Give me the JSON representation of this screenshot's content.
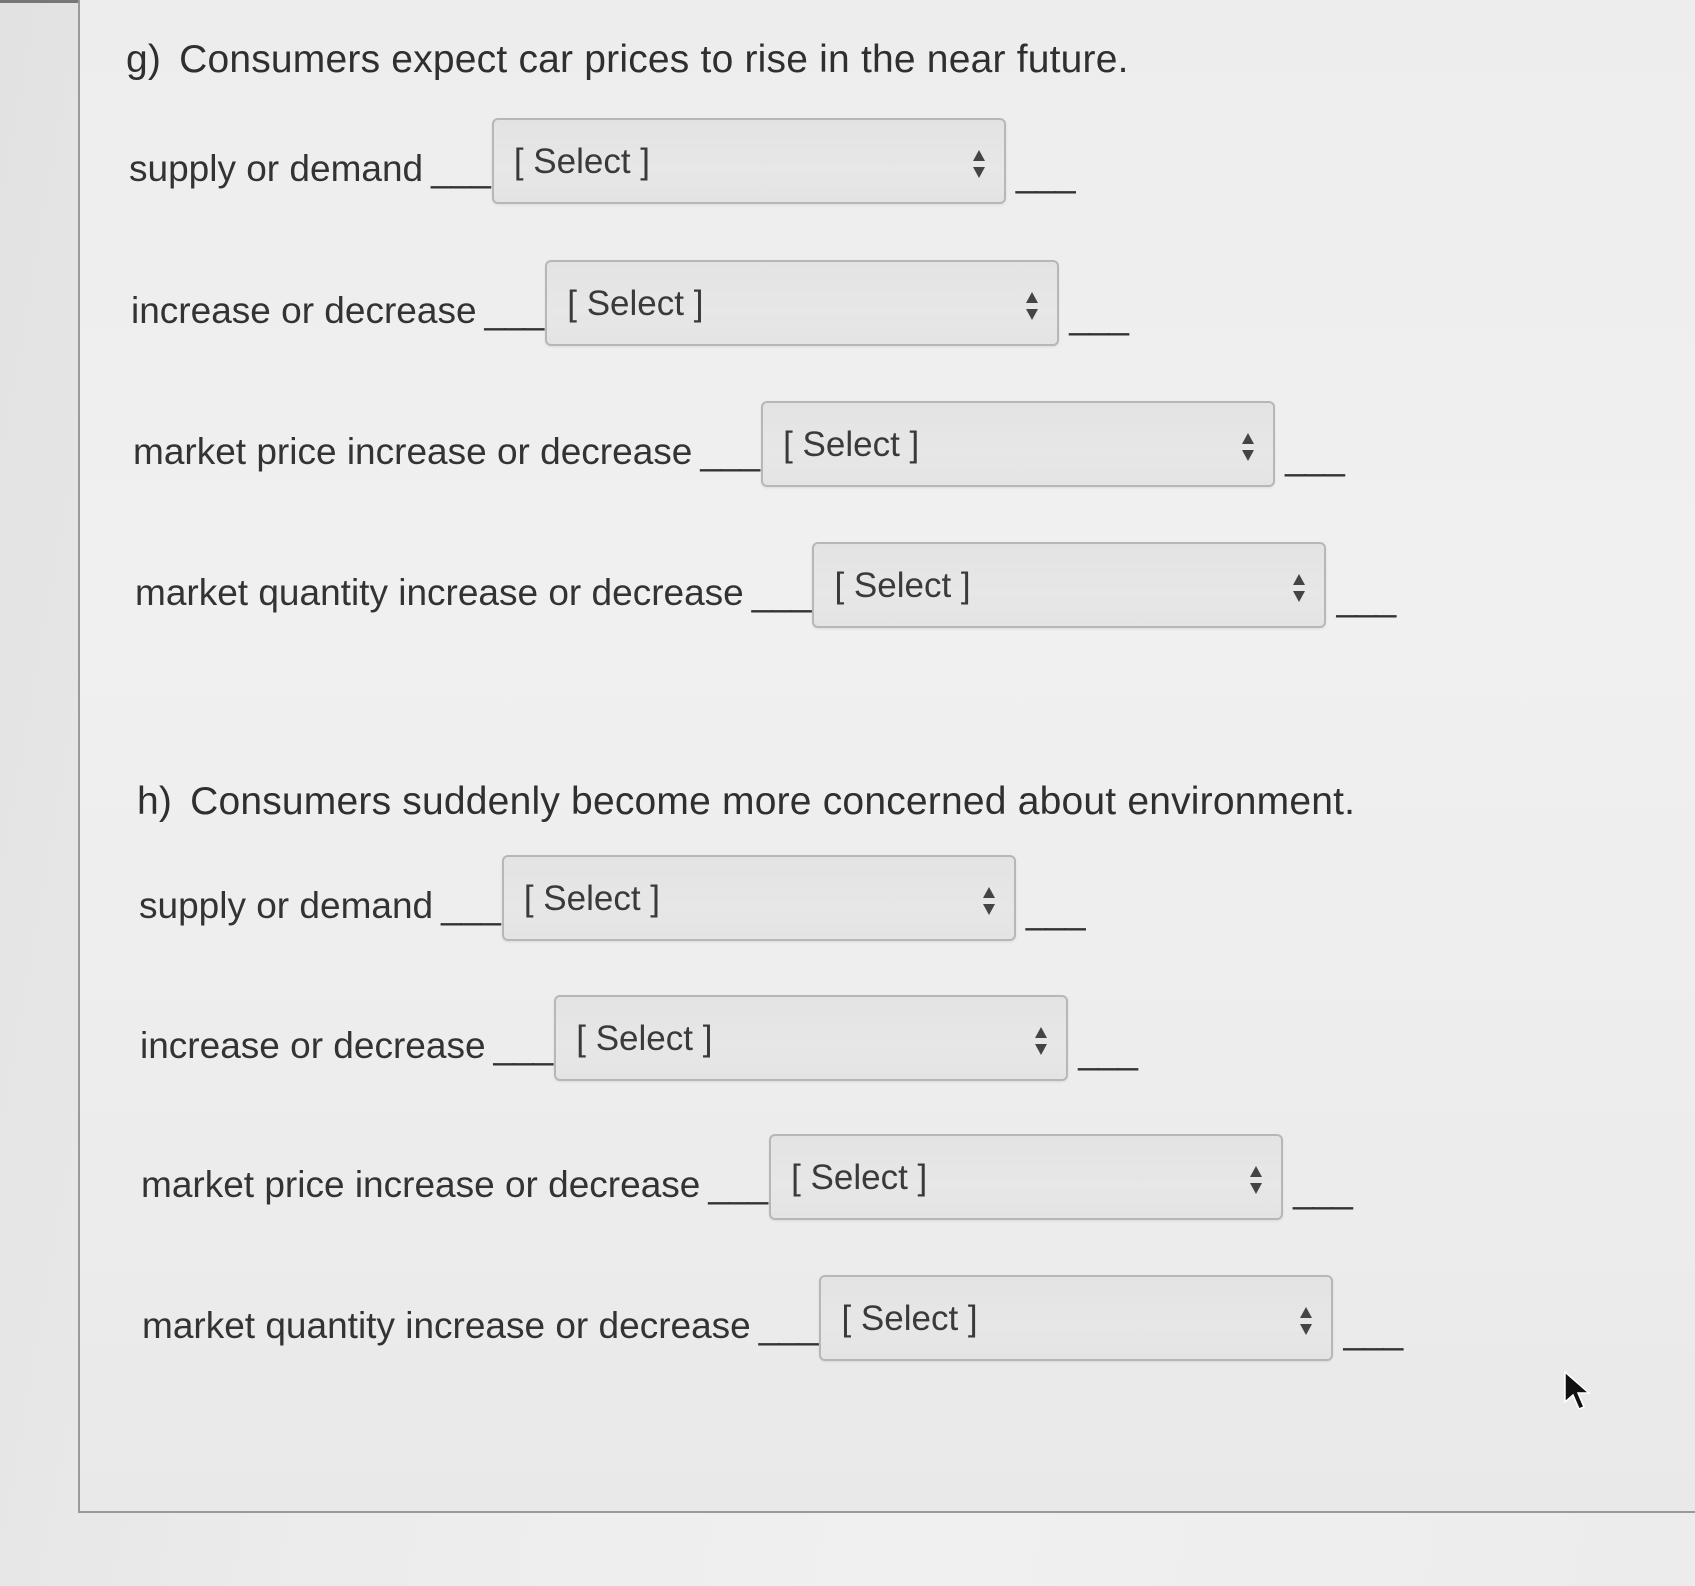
{
  "questions": [
    {
      "letter": "g)",
      "title": "Consumers expect car prices to rise in the near future.",
      "rows": [
        {
          "label": "supply or demand",
          "blank_before": "___",
          "select_value": "[ Select ]",
          "blank_after": "___"
        },
        {
          "label": "increase or decrease",
          "blank_before": "___",
          "select_value": "[ Select ]",
          "blank_after": "___"
        },
        {
          "label": "market price increase or decrease",
          "blank_before": "___",
          "select_value": "[ Select ]",
          "blank_after": "___"
        },
        {
          "label": "market quantity increase or decrease",
          "blank_before": "___",
          "select_value": "[ Select ]",
          "blank_after": "___"
        }
      ]
    },
    {
      "letter": "h)",
      "title": "Consumers suddenly become more concerned about environment.",
      "rows": [
        {
          "label": "supply or demand",
          "blank_before": "___",
          "select_value": "[ Select ]",
          "blank_after": "___"
        },
        {
          "label": "increase or decrease",
          "blank_before": "___",
          "select_value": "[ Select ]",
          "blank_after": "___"
        },
        {
          "label": "market price increase or decrease",
          "blank_before": "___",
          "select_value": "[ Select ]",
          "blank_after": "___"
        },
        {
          "label": "market quantity increase or decrease",
          "blank_before": "___",
          "select_value": "[ Select ]",
          "blank_after": "___"
        }
      ]
    }
  ],
  "icons": {
    "select_arrows": "up-down-arrows-icon",
    "pointer": "mouse-pointer-icon"
  }
}
